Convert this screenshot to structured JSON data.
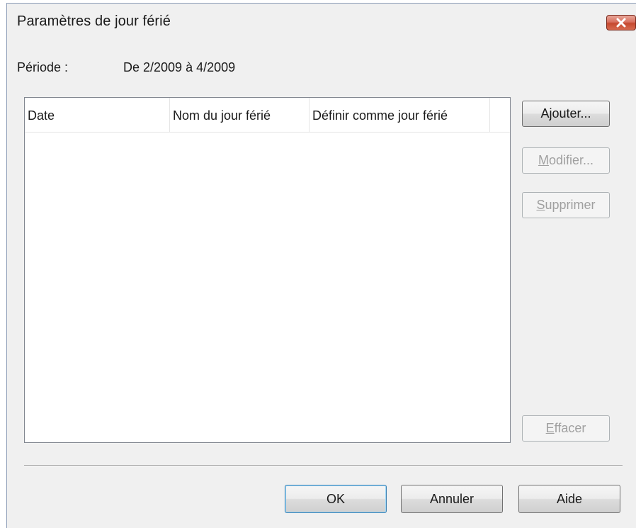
{
  "dialog": {
    "title": "Paramètres de jour férié",
    "period_label": "Période :",
    "period_value": "De 2/2009 à 4/2009"
  },
  "table": {
    "columns": [
      "Date",
      "Nom du jour férié",
      "Définir comme jour férié"
    ],
    "rows": []
  },
  "side_buttons": {
    "add": "Ajouter...",
    "modify_mnemonic": "M",
    "modify_rest": "odifier...",
    "delete_mnemonic": "S",
    "delete_rest": "upprimer",
    "clear_mnemonic": "E",
    "clear_rest": "ffacer"
  },
  "footer_buttons": {
    "ok": "OK",
    "cancel": "Annuler",
    "help": "Aide"
  },
  "icons": {
    "close": "close-icon"
  },
  "colors": {
    "window_bg": "#f0f0f0",
    "close_button": "#c6492f",
    "default_button_border": "#3c7fb1",
    "disabled_text": "#a0a0a0"
  }
}
